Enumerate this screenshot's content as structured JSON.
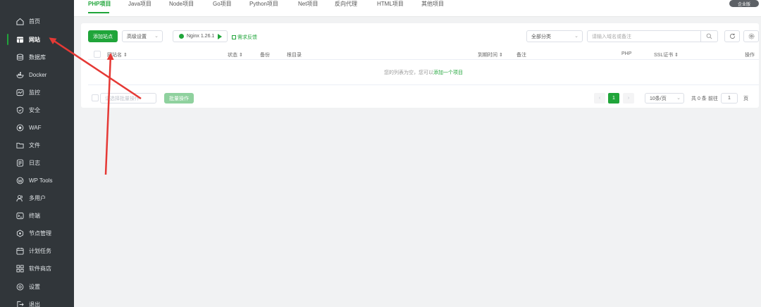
{
  "sidebar": {
    "items": [
      {
        "label": "首页",
        "icon": "home-icon"
      },
      {
        "label": "网站",
        "icon": "website-icon"
      },
      {
        "label": "数据库",
        "icon": "database-icon"
      },
      {
        "label": "Docker",
        "icon": "docker-icon"
      },
      {
        "label": "监控",
        "icon": "monitor-icon"
      },
      {
        "label": "安全",
        "icon": "shield-icon"
      },
      {
        "label": "WAF",
        "icon": "waf-icon"
      },
      {
        "label": "文件",
        "icon": "folder-icon"
      },
      {
        "label": "日志",
        "icon": "log-icon"
      },
      {
        "label": "WP Tools",
        "icon": "wordpress-icon"
      },
      {
        "label": "多用户",
        "icon": "users-icon"
      },
      {
        "label": "终端",
        "icon": "terminal-icon"
      },
      {
        "label": "节点管理",
        "icon": "node-icon"
      },
      {
        "label": "计划任务",
        "icon": "calendar-icon"
      },
      {
        "label": "软件商店",
        "icon": "store-icon"
      },
      {
        "label": "设置",
        "icon": "gear-icon"
      },
      {
        "label": "退出",
        "icon": "logout-icon"
      }
    ]
  },
  "tabs": [
    "PHP项目",
    "Java项目",
    "Node项目",
    "Go项目",
    "Python项目",
    "Net项目",
    "反向代理",
    "HTML项目",
    "其他项目"
  ],
  "enterprise_badge": "企业版",
  "toolbar": {
    "add_site": "添加站点",
    "advanced": "高级设置",
    "nginx": "Nginx 1.26.1",
    "feedback": "需求反馈",
    "category": "全部分类",
    "search_placeholder": "请输入域名或备注"
  },
  "table": {
    "headers": [
      "网站名",
      "状态",
      "备份",
      "根目录",
      "到期时间",
      "备注",
      "PHP",
      "SSL证书",
      "操作"
    ],
    "empty_text": "您的列表为空，您可以",
    "empty_link": "添加一个项目"
  },
  "footer": {
    "batch_placeholder": "请选择批量操作",
    "batch_button": "批量操作",
    "current_page": "1",
    "per_page": "10条/页",
    "total": "共 0 条",
    "goto": "前往",
    "goto_value": "1",
    "page_suffix": "页"
  },
  "colors": {
    "accent": "#20a53a",
    "sidebar_bg": "#31363a",
    "arrow": "#e53935"
  }
}
